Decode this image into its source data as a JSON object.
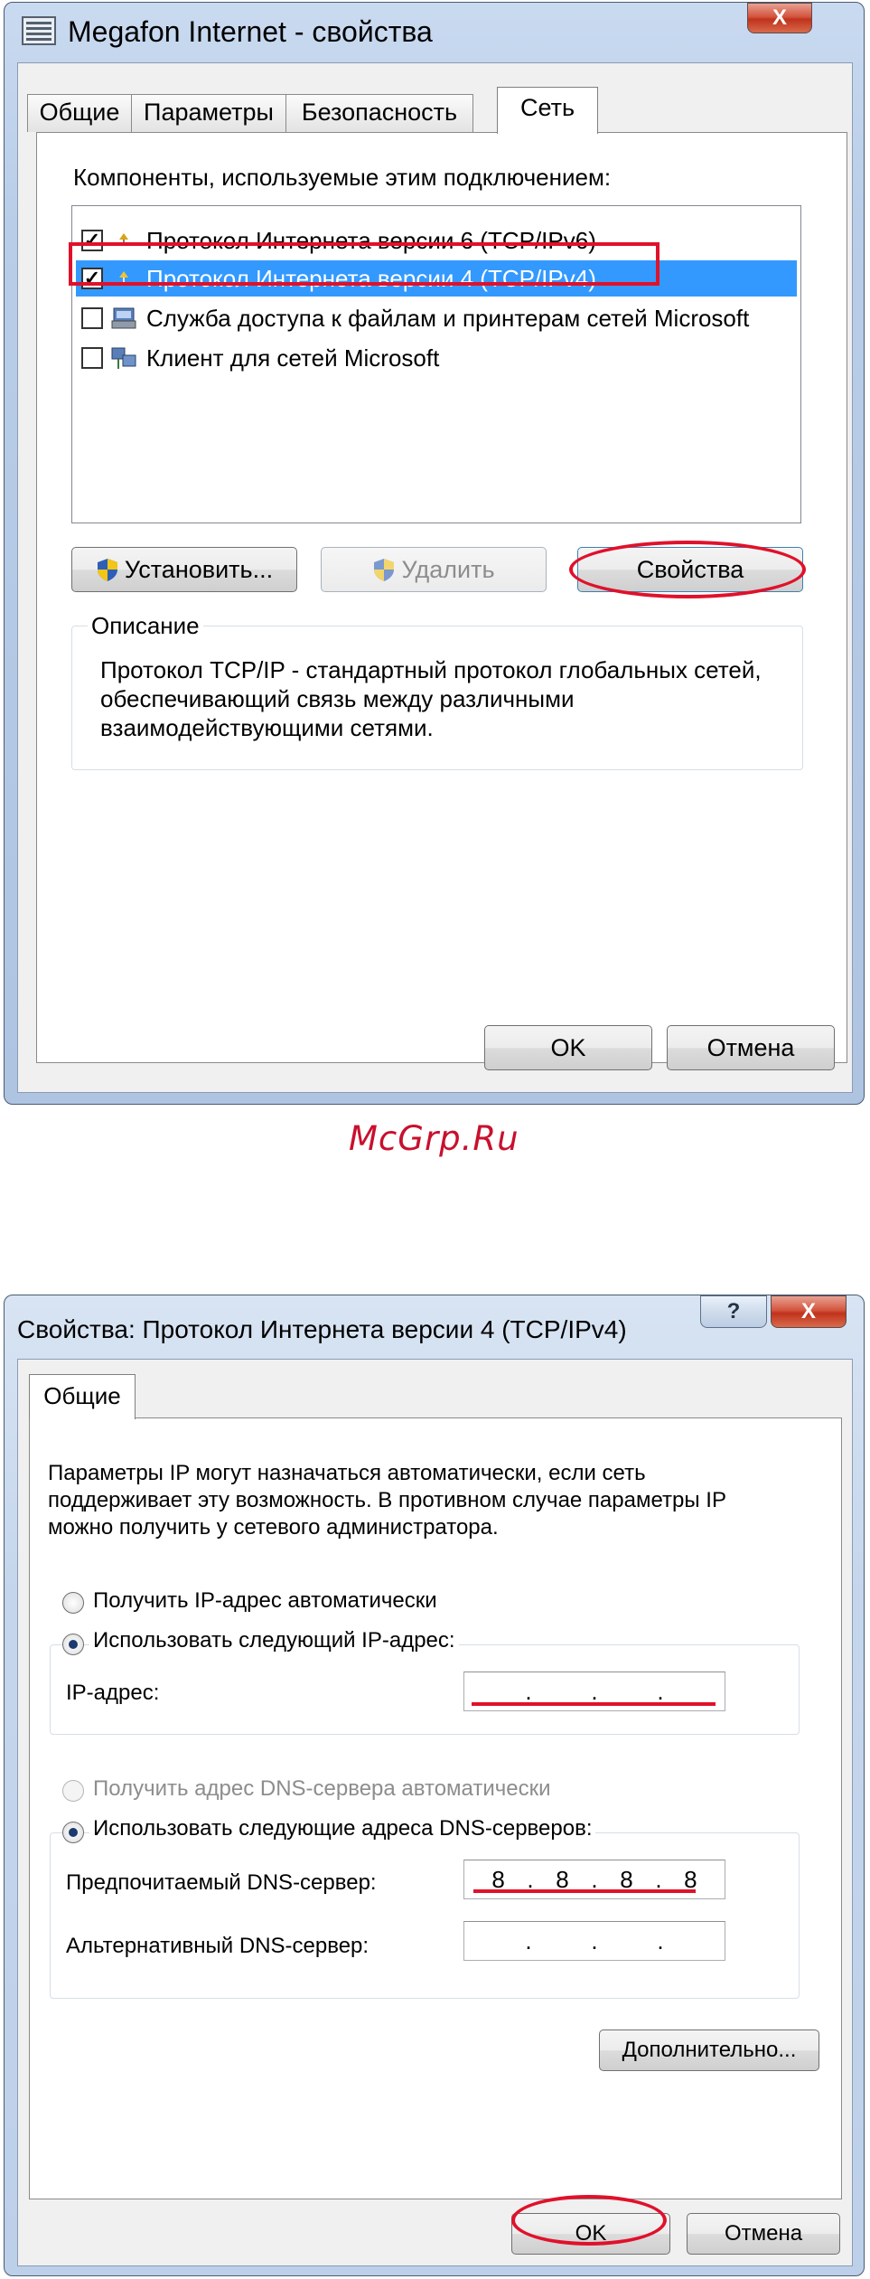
{
  "dialog1": {
    "title": "Megafon Internet - свойства",
    "tabs": [
      "Общие",
      "Параметры",
      "Безопасность",
      "Сеть"
    ],
    "components_label": "Компоненты, используемые этим подключением:",
    "components": [
      {
        "label": "Протокол Интернета версии 6 (TCP/IPv6)",
        "checked": true,
        "icon": "network-protocol-icon"
      },
      {
        "label": "Протокол Интернета версии 4 (TCP/IPv4)",
        "checked": true,
        "icon": "network-protocol-icon",
        "selected": true
      },
      {
        "label": "Служба доступа к файлам и принтерам сетей Microsoft",
        "checked": false,
        "icon": "file-printer-sharing-icon"
      },
      {
        "label": "Клиент для сетей Microsoft",
        "checked": false,
        "icon": "network-client-icon"
      }
    ],
    "install_label": "Установить...",
    "remove_label": "Удалить",
    "properties_label": "Свойства",
    "description_title": "Описание",
    "description_text": "Протокол TCP/IP - стандартный протокол глобальных сетей, обеспечивающий связь между различными взаимодействующими сетями.",
    "ok_label": "OK",
    "cancel_label": "Отмена",
    "close_glyph": "X"
  },
  "watermark": "McGrp.Ru",
  "dialog2": {
    "title": "Свойства: Протокол Интернета версии 4 (TCP/IPv4)",
    "help_glyph": "?",
    "close_glyph": "X",
    "tab": "Общие",
    "intro_text": "Параметры IP могут назначаться автоматически, если сеть поддерживает эту возможность. В противном случае параметры IP можно получить у сетевого администратора.",
    "ip_auto_label": "Получить IP-адрес автоматически",
    "ip_manual_label": "Использовать следующий IP-адрес:",
    "ip_address_label": "IP-адрес:",
    "ip_address_value": [
      "",
      "",
      "",
      ""
    ],
    "dns_auto_label": "Получить адрес DNS-сервера автоматически",
    "dns_manual_label": "Использовать следующие адреса DNS-серверов:",
    "preferred_dns_label": "Предпочитаемый DNS-сервер:",
    "preferred_dns_value": [
      "8",
      "8",
      "8",
      "8"
    ],
    "alternate_dns_label": "Альтернативный DNS-сервер:",
    "alternate_dns_value": [
      "",
      "",
      "",
      ""
    ],
    "advanced_label": "Дополнительно...",
    "ok_label": "OK",
    "cancel_label": "Отмена",
    "ip_mode": "manual",
    "dns_mode": "manual"
  },
  "colors": {
    "highlight": "#e0112b",
    "selection": "#3399ff",
    "watermark": "#c8102e"
  }
}
